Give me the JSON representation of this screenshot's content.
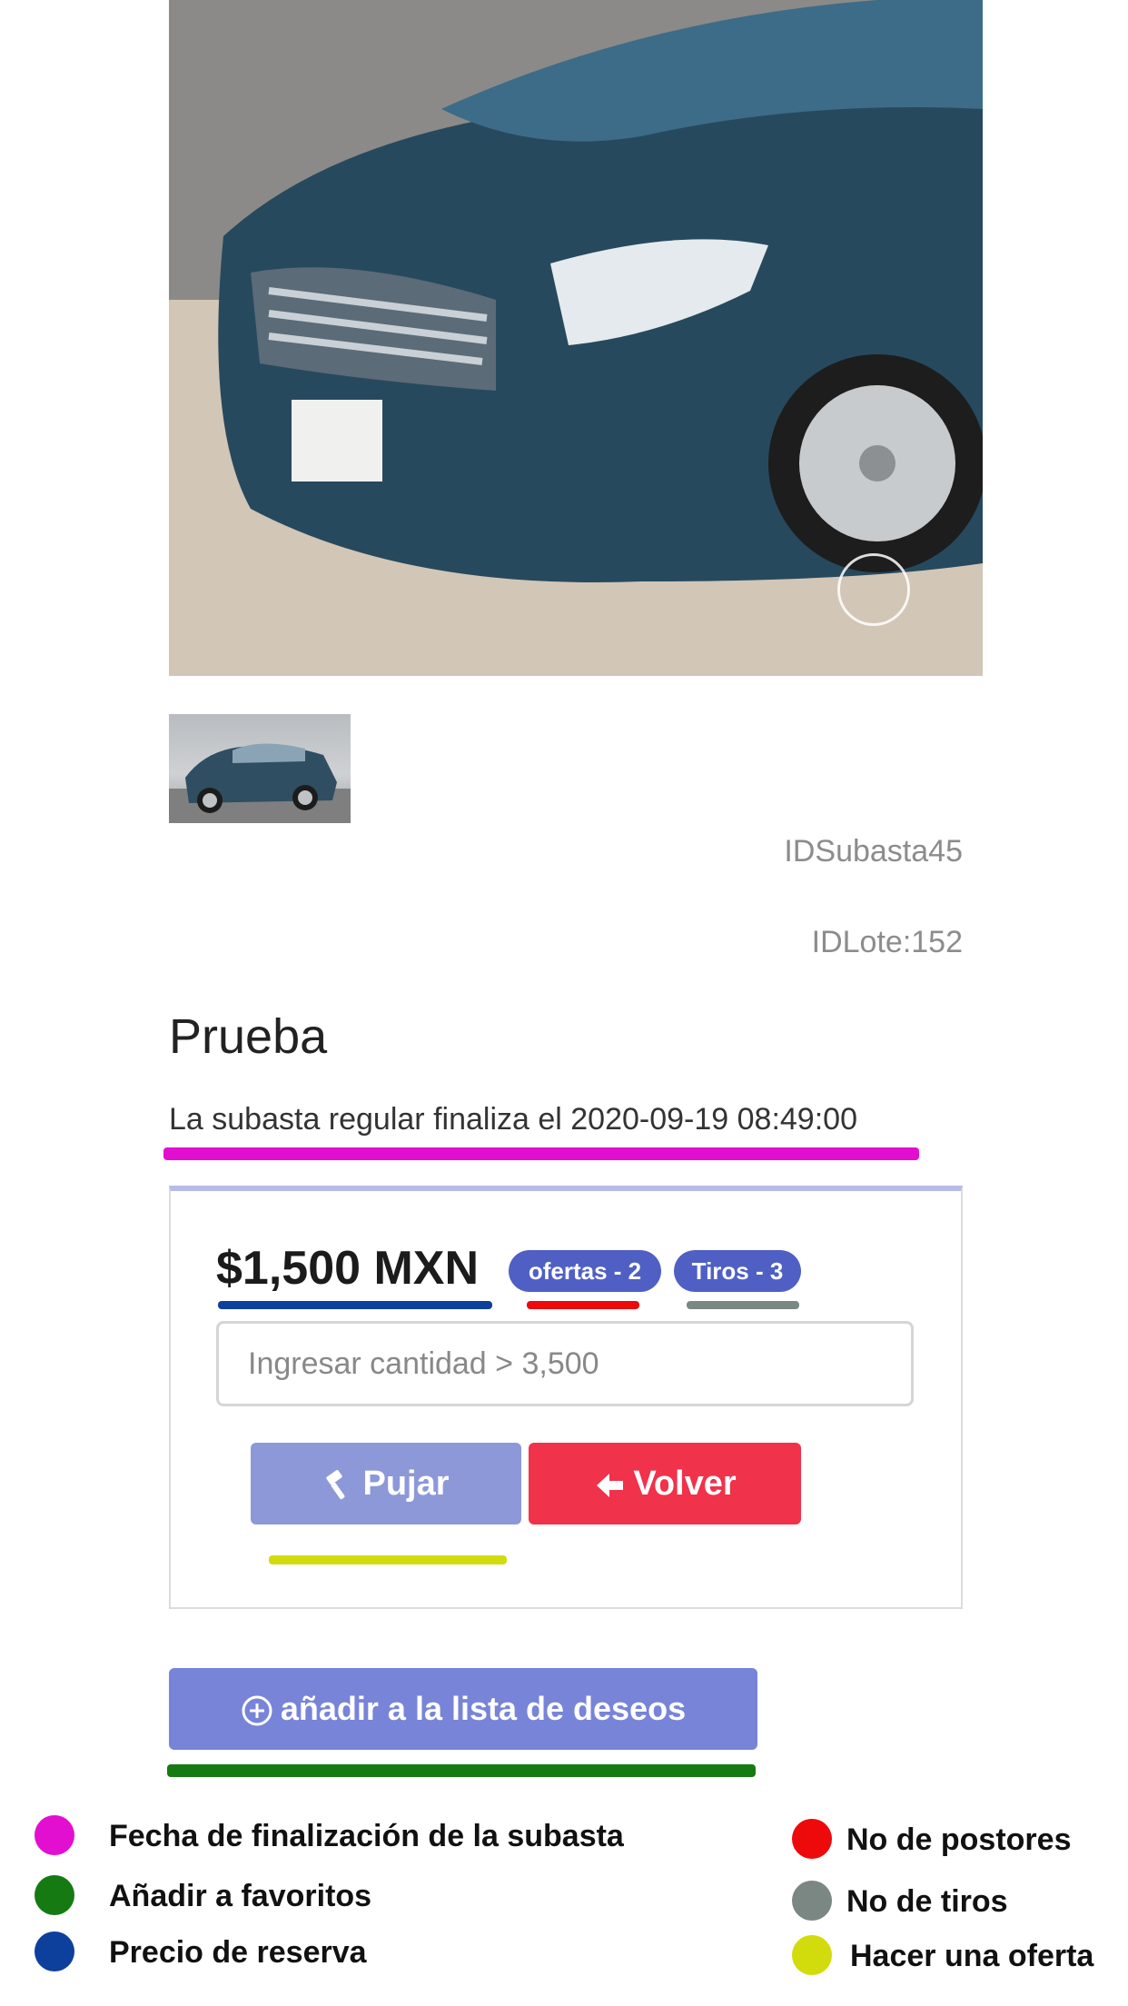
{
  "lot": {
    "auction_id": "IDSubasta45",
    "lot_id": "IDLote:152",
    "title": "Prueba",
    "end_text": "La subasta regular finaliza el 2020-09-19 08:49:00"
  },
  "bid": {
    "price": "$1,500 MXN",
    "offers_badge": "ofertas - 2",
    "shots_badge": "Tiros - 3",
    "amount_placeholder": "Ingresar cantidad > 3,500",
    "bid_label": "Pujar",
    "back_label": "Volver",
    "wishlist_label": "añadir a la lista de deseos"
  },
  "legend": [
    {
      "label": "Fecha de finalización de la subasta",
      "color": "#e20fd0"
    },
    {
      "label": "Añadir a favoritos",
      "color": "#157a12"
    },
    {
      "label": "Precio de reserva",
      "color": "#0d3f9c"
    },
    {
      "label": "No de postores",
      "color": "#ee0a0a"
    },
    {
      "label": "No de tiros",
      "color": "#7a8783"
    },
    {
      "label": "Hacer una oferta",
      "color": "#d2db0c"
    }
  ],
  "colors": {
    "accent": "#4f5fc4",
    "bid_button": "#8d98d9",
    "back_button": "#f0324a",
    "wishlist_button": "#7884d8"
  }
}
